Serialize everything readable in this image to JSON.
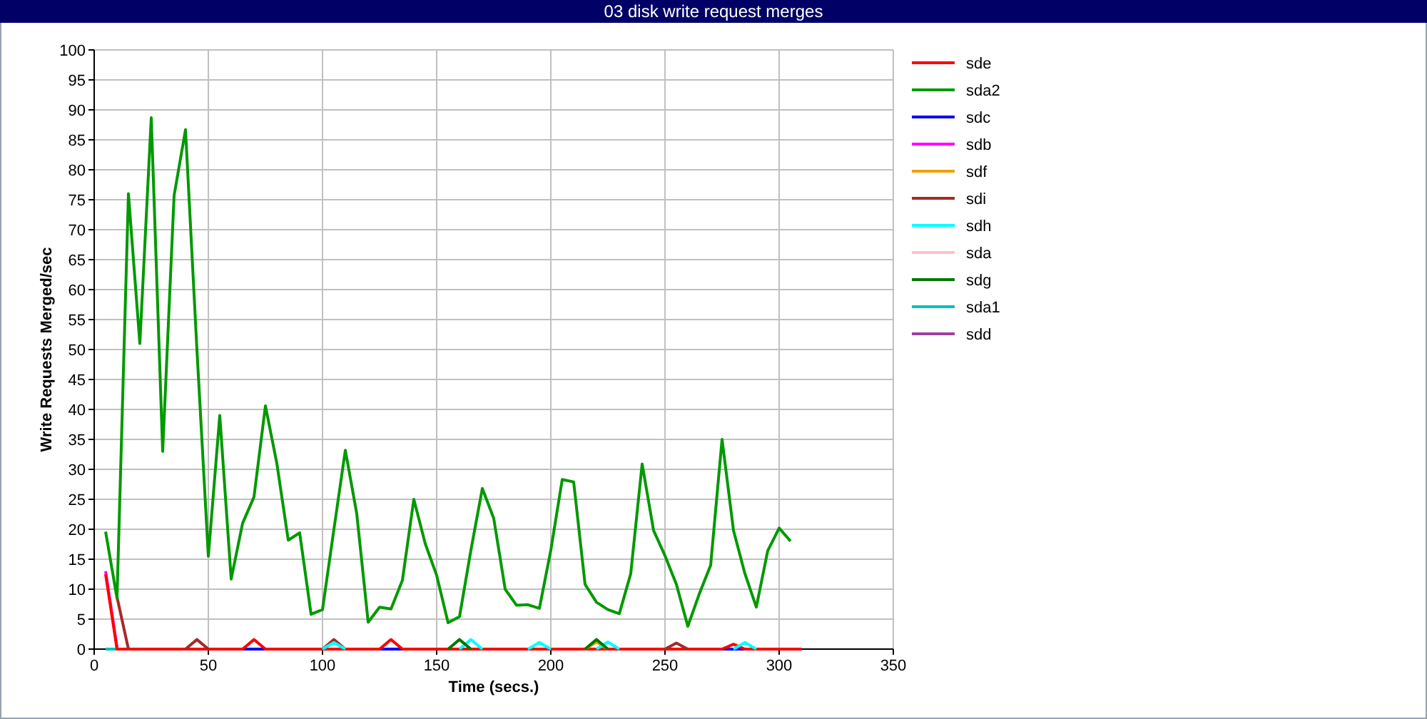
{
  "chart_data": {
    "type": "line",
    "title": "03 disk write request merges",
    "xlabel": "Time (secs.)",
    "ylabel": "Write Requests Merged/sec",
    "xlim": [
      0,
      350
    ],
    "ylim": [
      0,
      100
    ],
    "grid": true,
    "legend": true,
    "xticks": [
      0,
      50,
      100,
      150,
      200,
      250,
      300,
      350
    ],
    "yticks": [
      0,
      5,
      10,
      15,
      20,
      25,
      30,
      35,
      40,
      45,
      50,
      55,
      60,
      65,
      70,
      75,
      80,
      85,
      90,
      95,
      100
    ],
    "x": [
      5,
      10,
      15,
      20,
      25,
      30,
      35,
      40,
      45,
      50,
      55,
      60,
      65,
      70,
      75,
      80,
      85,
      90,
      95,
      100,
      105,
      110,
      115,
      120,
      125,
      130,
      135,
      140,
      145,
      150,
      155,
      160,
      165,
      170,
      175,
      180,
      185,
      190,
      195,
      200,
      205,
      210,
      215,
      220,
      225,
      230,
      235,
      240,
      245,
      250,
      255,
      260,
      265,
      270,
      275,
      280,
      285,
      290,
      295,
      300,
      305,
      310
    ],
    "series": [
      {
        "name": "sde",
        "color": "#ff0000",
        "values": [
          12.5,
          0,
          0,
          0,
          0,
          0,
          0,
          0,
          0,
          0,
          0,
          0,
          0,
          1.6,
          0,
          0,
          0,
          0,
          0,
          0,
          0,
          0,
          0,
          0,
          0,
          1.6,
          0,
          0,
          0,
          0,
          0,
          0,
          0,
          0,
          0,
          0,
          0,
          0,
          0,
          0,
          0,
          0,
          0,
          0,
          0,
          0,
          0,
          0,
          0,
          0,
          0,
          0,
          0,
          0,
          0,
          0.8,
          0,
          0,
          0,
          0,
          0,
          0
        ]
      },
      {
        "name": "sda2",
        "color": "#009900",
        "values": [
          19.6,
          8.5,
          76,
          51,
          88.7,
          33,
          75.7,
          86.7,
          50,
          15.5,
          39,
          11.7,
          21,
          25.4,
          40.6,
          31,
          18.2,
          19.4,
          5.8,
          6.6,
          20,
          33.2,
          22.6,
          4.5,
          7,
          6.7,
          11.5,
          25,
          17.6,
          12.3,
          4.4,
          5.4,
          16.5,
          26.8,
          21.8,
          10,
          7.3,
          7.4,
          6.8,
          16.5,
          28.3,
          27.9,
          10.8,
          7.8,
          6.6,
          5.9,
          12.6,
          30.9,
          19.8,
          15.6,
          10.8,
          3.8,
          9.2,
          14,
          35,
          19.8,
          12.6,
          7,
          16.4,
          20.2,
          18,
          null
        ]
      },
      {
        "name": "sdc",
        "color": "#0000ff",
        "values": [
          null,
          null,
          null,
          null,
          null,
          null,
          null,
          null,
          null,
          null,
          null,
          null,
          0,
          0,
          0,
          null,
          null,
          null,
          null,
          null,
          null,
          null,
          null,
          null,
          0,
          0,
          0,
          null,
          null,
          null,
          null,
          null,
          null,
          null,
          null,
          null,
          null,
          null,
          null,
          null,
          null,
          null,
          null,
          null,
          null,
          null,
          null,
          null,
          null,
          null,
          null,
          null,
          null,
          null,
          0,
          0,
          0,
          null,
          null,
          null,
          null,
          null
        ]
      },
      {
        "name": "sdb",
        "color": "#ff00ff",
        "values": [
          13,
          0.3,
          null,
          null,
          null,
          null,
          null,
          null,
          null,
          null,
          null,
          null,
          null,
          null,
          null,
          null,
          null,
          null,
          null,
          null,
          null,
          null,
          null,
          null,
          null,
          null,
          null,
          null,
          null,
          null,
          null,
          null,
          null,
          null,
          null,
          null,
          null,
          null,
          null,
          null,
          null,
          null,
          null,
          null,
          null,
          null,
          null,
          null,
          null,
          null,
          null,
          null,
          null,
          null,
          null,
          null,
          null,
          null,
          null,
          null,
          null,
          null
        ]
      },
      {
        "name": "sdf",
        "color": "#f0a000",
        "values": [
          null,
          null,
          null,
          null,
          null,
          null,
          null,
          null,
          null,
          null,
          null,
          null,
          null,
          null,
          null,
          null,
          null,
          null,
          null,
          null,
          null,
          null,
          null,
          null,
          null,
          null,
          null,
          null,
          null,
          null,
          null,
          null,
          null,
          null,
          null,
          null,
          null,
          null,
          null,
          null,
          null,
          null,
          0,
          1.2,
          0,
          null,
          null,
          null,
          null,
          null,
          null,
          null,
          null,
          null,
          null,
          null,
          null,
          null,
          null,
          null,
          null,
          null
        ]
      },
      {
        "name": "sdi",
        "color": "#a52a2a",
        "values": [
          null,
          8.7,
          0,
          null,
          null,
          null,
          null,
          0,
          1.6,
          0,
          null,
          null,
          null,
          null,
          null,
          null,
          null,
          null,
          null,
          0,
          1.6,
          0,
          null,
          null,
          null,
          null,
          null,
          null,
          null,
          null,
          null,
          null,
          null,
          null,
          null,
          null,
          null,
          null,
          null,
          null,
          null,
          null,
          null,
          null,
          null,
          null,
          null,
          null,
          null,
          0,
          1,
          0,
          null,
          null,
          null,
          null,
          null,
          null,
          null,
          null,
          null,
          null
        ]
      },
      {
        "name": "sdh",
        "color": "#00ffff",
        "values": [
          null,
          null,
          null,
          null,
          null,
          null,
          null,
          null,
          null,
          null,
          null,
          null,
          null,
          null,
          null,
          null,
          null,
          null,
          null,
          0,
          1.1,
          0,
          null,
          null,
          null,
          null,
          null,
          null,
          null,
          null,
          null,
          0,
          1.6,
          0,
          null,
          null,
          null,
          0,
          1.1,
          0,
          null,
          null,
          null,
          0,
          1.2,
          0,
          null,
          null,
          null,
          null,
          null,
          null,
          null,
          null,
          null,
          0,
          1.1,
          0,
          null,
          null,
          null,
          null
        ]
      },
      {
        "name": "sda",
        "color": "#ffc0cb",
        "values": [
          null,
          null,
          null,
          null,
          null,
          null,
          null,
          null,
          null,
          null,
          null,
          null,
          null,
          null,
          null,
          null,
          null,
          null,
          null,
          null,
          null,
          null,
          null,
          null,
          null,
          null,
          null,
          null,
          null,
          null,
          null,
          null,
          null,
          null,
          null,
          null,
          null,
          null,
          null,
          null,
          null,
          null,
          null,
          null,
          null,
          null,
          null,
          null,
          null,
          null,
          null,
          null,
          null,
          null,
          null,
          null,
          null,
          null,
          null,
          null,
          null,
          null
        ]
      },
      {
        "name": "sdg",
        "color": "#007700",
        "values": [
          null,
          null,
          null,
          null,
          null,
          null,
          null,
          null,
          null,
          null,
          null,
          null,
          null,
          null,
          null,
          null,
          null,
          null,
          null,
          null,
          null,
          null,
          null,
          null,
          null,
          null,
          null,
          null,
          null,
          null,
          0,
          1.6,
          0,
          null,
          null,
          null,
          null,
          null,
          null,
          null,
          null,
          null,
          0,
          1.6,
          0,
          null,
          null,
          null,
          null,
          null,
          null,
          null,
          null,
          null,
          null,
          null,
          null,
          null,
          null,
          null,
          null,
          null
        ]
      },
      {
        "name": "sda1",
        "color": "#00c0c0",
        "values": [
          0,
          0,
          null,
          null,
          null,
          null,
          null,
          null,
          null,
          null,
          null,
          null,
          null,
          null,
          null,
          null,
          null,
          null,
          null,
          null,
          null,
          null,
          null,
          null,
          null,
          null,
          null,
          null,
          null,
          null,
          null,
          null,
          null,
          null,
          null,
          null,
          null,
          null,
          null,
          null,
          null,
          null,
          null,
          null,
          null,
          null,
          null,
          null,
          null,
          null,
          null,
          null,
          null,
          null,
          null,
          null,
          null,
          null,
          null,
          null,
          null,
          null
        ]
      },
      {
        "name": "sdd",
        "color": "#a040a0",
        "values": [
          null,
          null,
          null,
          null,
          null,
          null,
          null,
          null,
          null,
          null,
          null,
          null,
          null,
          null,
          null,
          null,
          null,
          null,
          null,
          null,
          null,
          null,
          null,
          null,
          null,
          null,
          null,
          null,
          null,
          null,
          null,
          null,
          null,
          null,
          null,
          null,
          null,
          null,
          null,
          null,
          null,
          null,
          null,
          null,
          null,
          null,
          null,
          null,
          null,
          null,
          null,
          null,
          null,
          null,
          null,
          null,
          null,
          null,
          null,
          null,
          null,
          null
        ]
      }
    ]
  }
}
